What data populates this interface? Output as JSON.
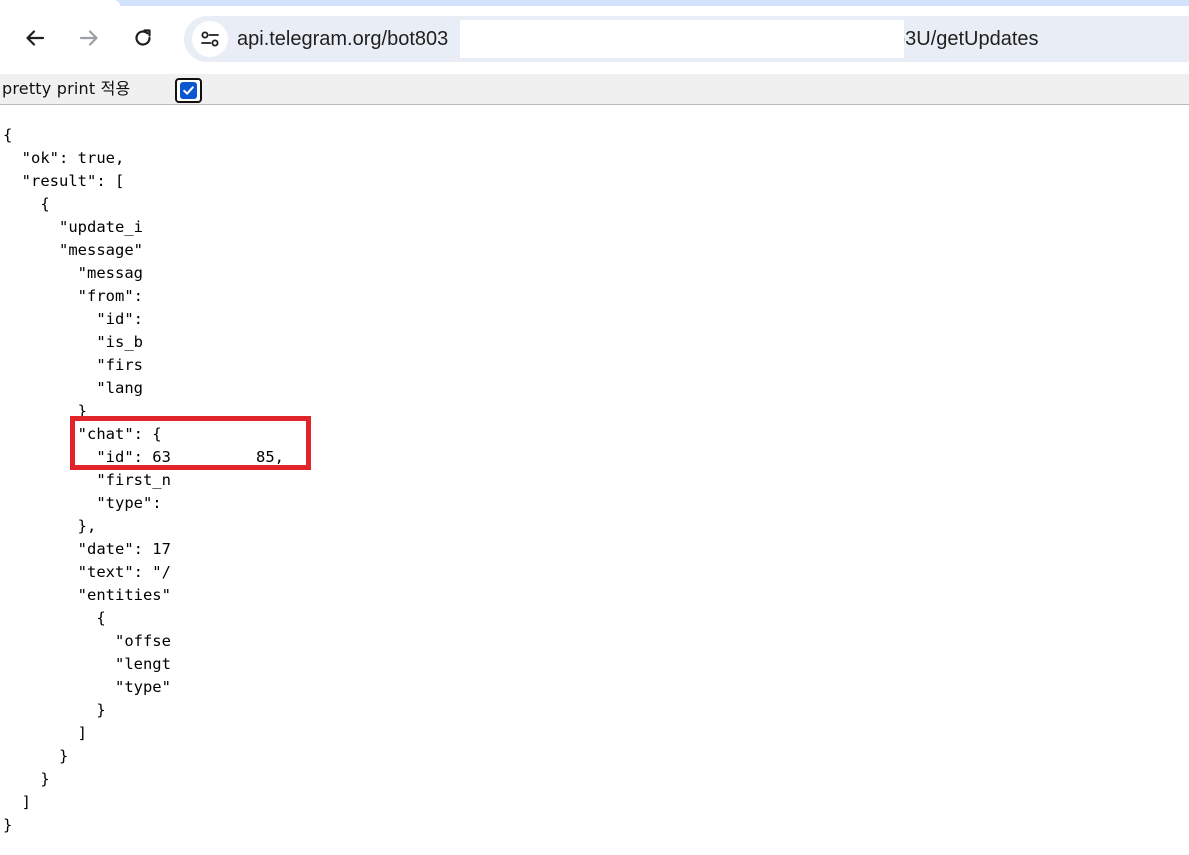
{
  "browser": {
    "url_prefix": "api.telegram.org/bot803",
    "url_suffix": "b3U/getUpdates",
    "icons": {
      "back": "arrow-left-icon",
      "forward": "arrow-right-icon",
      "reload": "reload-icon",
      "site_info": "tune-icon"
    }
  },
  "pretty_print": {
    "label": "pretty print 적용",
    "checked": true
  },
  "json_lines": [
    "{",
    "  \"ok\": true,",
    "  \"result\": [",
    "    {",
    "      \"update_i",
    "      \"message\"",
    "        \"messag",
    "        \"from\":",
    "          \"id\":",
    "          \"is_b",
    "          \"firs",
    "          \"lang",
    "        }",
    "        \"chat\": {",
    "          \"id\": 63",
    "          \"first_n",
    "          \"type\":",
    "        },",
    "        \"date\": 17",
    "        \"text\": \"/",
    "        \"entities\"",
    "          {",
    "            \"offse",
    "            \"lengt",
    "            \"type\"",
    "          }",
    "        ]",
    "      }",
    "    }",
    "  ]",
    "}"
  ],
  "chat_id_tail": "85,",
  "colors": {
    "highlight": "#e0242a",
    "checkbox": "#0b57d0",
    "omnibox_bg": "#e9eef6"
  }
}
